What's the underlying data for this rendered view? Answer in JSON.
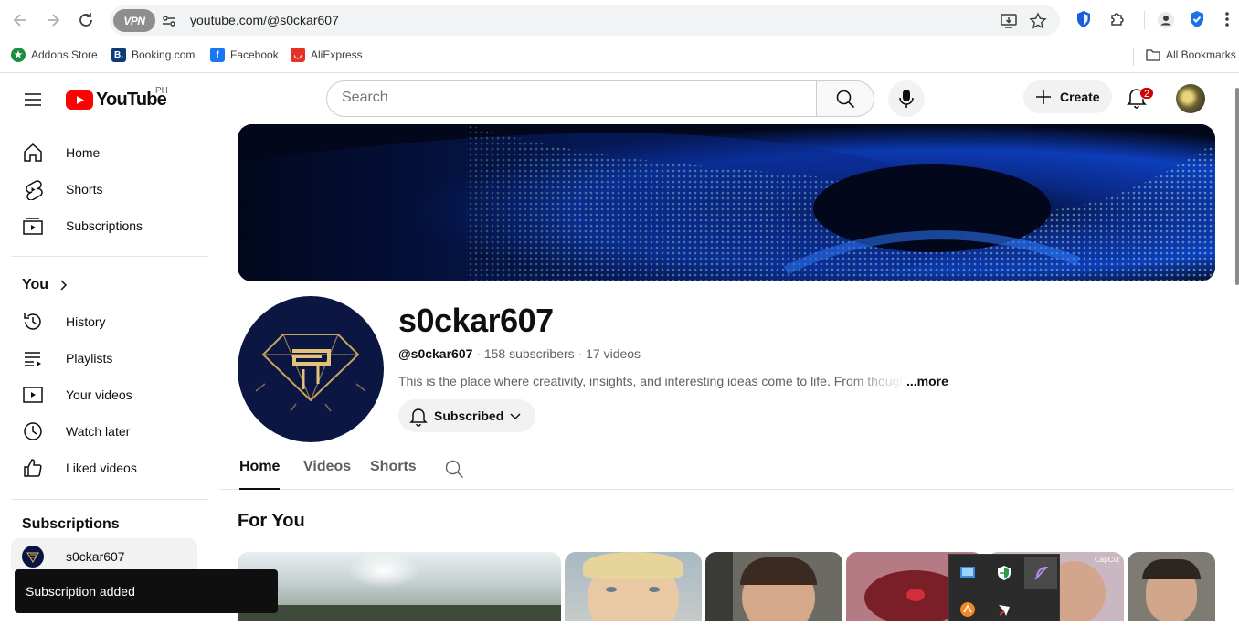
{
  "browser": {
    "url": "youtube.com/@s0ckar607",
    "vpn_label": "VPN",
    "bookmarks": [
      {
        "label": "Addons Store",
        "icon": "addons-store-icon",
        "color": "#1e8e3e"
      },
      {
        "label": "Booking.com",
        "icon": "booking-icon",
        "color": "#0c3b7c"
      },
      {
        "label": "Facebook",
        "icon": "facebook-icon",
        "color": "#1877f2"
      },
      {
        "label": "AliExpress",
        "icon": "aliexpress-icon",
        "color": "#e43225"
      }
    ],
    "all_bookmarks_label": "All Bookmarks"
  },
  "masthead": {
    "logo_text": "YouTube",
    "country_code": "PH",
    "search_placeholder": "Search",
    "create_label": "Create",
    "notification_count": "2"
  },
  "sidebar": {
    "main": [
      {
        "label": "Home",
        "icon": "home-icon"
      },
      {
        "label": "Shorts",
        "icon": "shorts-icon"
      },
      {
        "label": "Subscriptions",
        "icon": "subscriptions-icon"
      }
    ],
    "you_label": "You",
    "you": [
      {
        "label": "History",
        "icon": "history-icon"
      },
      {
        "label": "Playlists",
        "icon": "playlists-icon"
      },
      {
        "label": "Your videos",
        "icon": "your-videos-icon"
      },
      {
        "label": "Watch later",
        "icon": "watch-later-icon"
      },
      {
        "label": "Liked videos",
        "icon": "liked-videos-icon"
      }
    ],
    "subscriptions_label": "Subscriptions",
    "subscriptions": [
      {
        "label": "s0ckar607"
      }
    ]
  },
  "channel": {
    "name": "s0ckar607",
    "handle": "@s0ckar607",
    "subscribers": "158 subscribers",
    "videos": "17 videos",
    "separator": "·",
    "description": "This is the place where creativity, insights, and interesting ideas come to life. From thoughtful",
    "more_label": "...more",
    "subscribed_label": "Subscribed"
  },
  "tabs": [
    {
      "label": "Home",
      "active": true
    },
    {
      "label": "Videos",
      "active": false
    },
    {
      "label": "Shorts",
      "active": false
    }
  ],
  "section_title": "For You",
  "toast": "Subscription added",
  "colors": {
    "youtube_red": "#ff0000",
    "notification_red": "#cc0000",
    "banner_bg": "#02071c",
    "avatar_bg": "#0b1642",
    "gold": "#c9a55a"
  }
}
